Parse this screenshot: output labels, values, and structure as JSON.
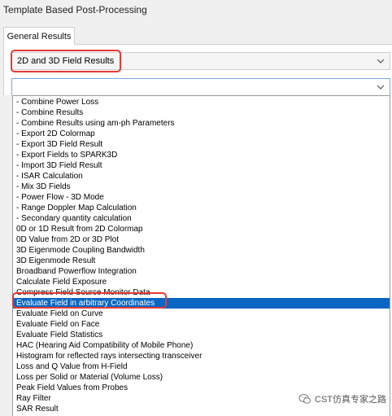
{
  "window": {
    "title": "Template Based Post-Processing"
  },
  "tabs": [
    {
      "label": "General Results"
    }
  ],
  "category_combo": {
    "value": "2D and 3D Field Results"
  },
  "template_combo": {
    "value": ""
  },
  "dropdown": {
    "selected_index": 19,
    "items": [
      "- Combine Power Loss",
      "- Combine Results",
      "- Combine Results using am-ph Parameters",
      "- Export 2D Colormap",
      "- Export 3D Field Result",
      "- Export Fields to SPARK3D",
      "- Import 3D Field Result",
      "- ISAR Calculation",
      "- Mix 3D Fields",
      "- Power Flow - 3D Mode",
      "- Range Doppler Map Calculation",
      "- Secondary quantity calculation",
      "0D or 1D Result from 2D Colormap",
      "0D Value from 2D or 3D Plot",
      "3D Eigenmode Coupling Bandwidth",
      "3D Eigenmode Result",
      "Broadband Powerflow Integration",
      "Calculate Field Exposure",
      "Compress Field Source Monitor Data",
      "Evaluate Field in arbitrary Coordinates",
      "Evaluate Field on Curve",
      "Evaluate Field on Face",
      "Evaluate Field Statistics",
      "HAC (Hearing Aid Compatibility of Mobile Phone)",
      "Histogram for reflected rays intersecting transceiver",
      "Loss and Q Value from H-Field",
      "Loss per Solid or Material (Volume Loss)",
      "Peak Field Values from Probes",
      "Ray Filter",
      "SAR Result"
    ]
  },
  "watermark": {
    "text": "CST仿真专家之路"
  },
  "colors": {
    "highlight_box": "#e53935",
    "selection": "#0a66c2"
  }
}
